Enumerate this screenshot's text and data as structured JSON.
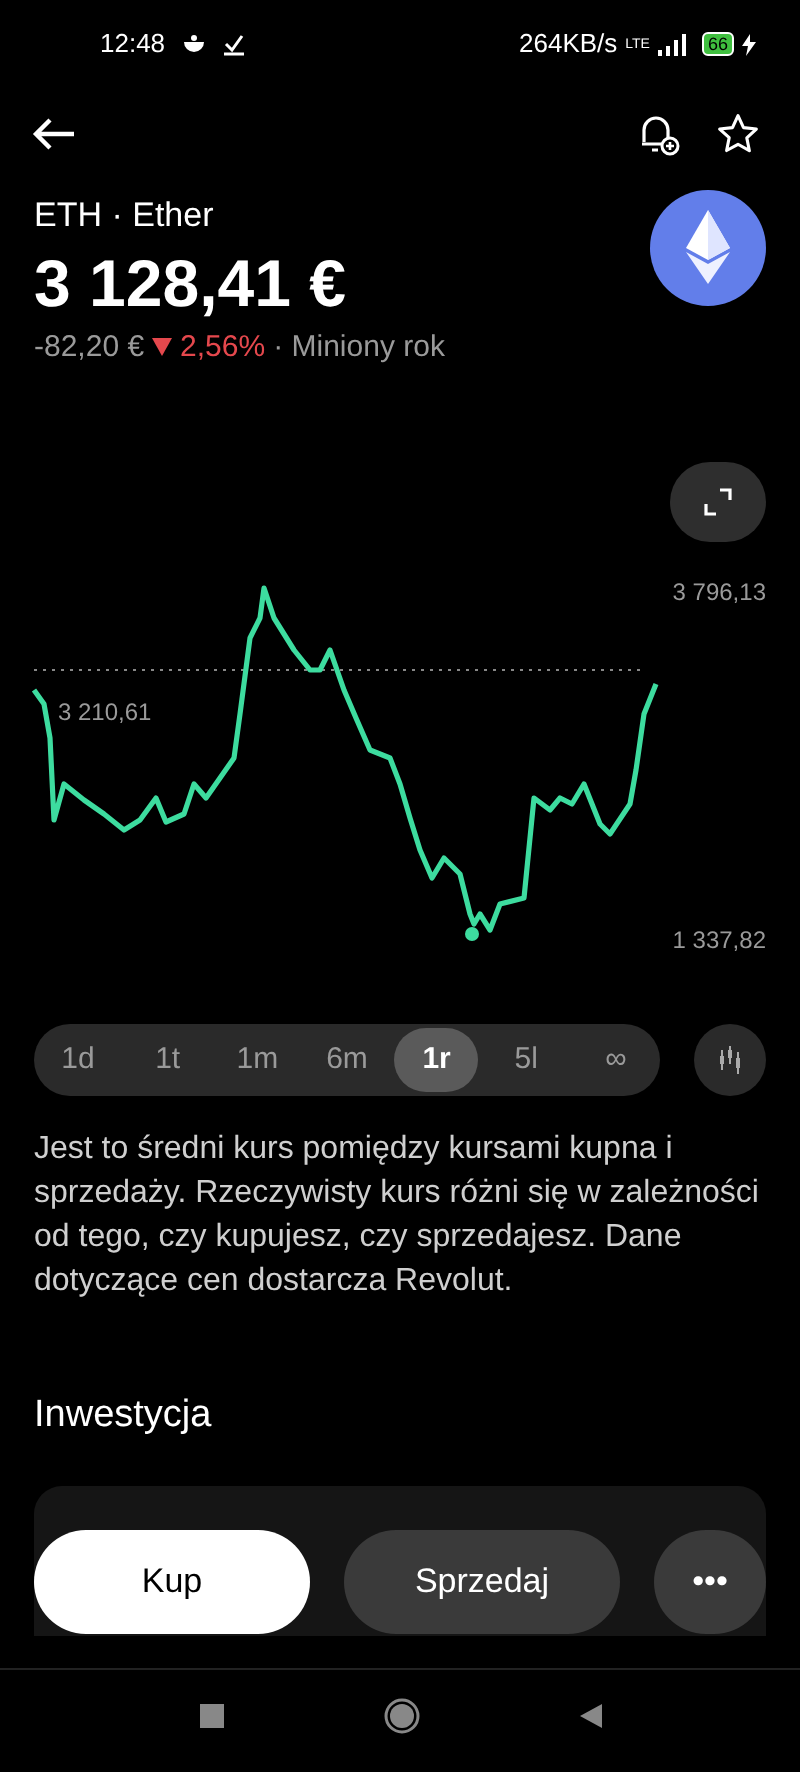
{
  "status_bar": {
    "time": "12:48",
    "speed": "264KB/s",
    "network": "LTE",
    "battery": "66"
  },
  "asset": {
    "name": "ETH · Ether",
    "price": "3 128,41 €",
    "change": "-82,20 €",
    "change_percent": "2,56%",
    "falling": true,
    "period": "· Miniony rok"
  },
  "chart": {
    "max_label": "3 796,13",
    "start_label": "3 210,61",
    "min_label": "1 337,82"
  },
  "ranges": [
    {
      "label": "1d",
      "selected": false
    },
    {
      "label": "1t",
      "selected": false
    },
    {
      "label": "1m",
      "selected": false
    },
    {
      "label": "6m",
      "selected": false
    },
    {
      "label": "1r",
      "selected": true
    },
    {
      "label": "5l",
      "selected": false
    },
    {
      "label": "∞",
      "selected": false
    }
  ],
  "disclaimer": "Jest to średni kurs pomiędzy kursami kupna i sprzedaży. Rzeczywisty kurs różni się w zależności od tego, czy kupujesz, czy sprzedajesz. Dane dotyczące cen dostarcza Revolut.",
  "section_title": "Inwestycja",
  "actions": [
    {
      "label": "Kup",
      "kind": "primary"
    },
    {
      "label": "Sprzedaj",
      "kind": "secondary"
    },
    {
      "label": "•••",
      "kind": "more"
    }
  ]
}
